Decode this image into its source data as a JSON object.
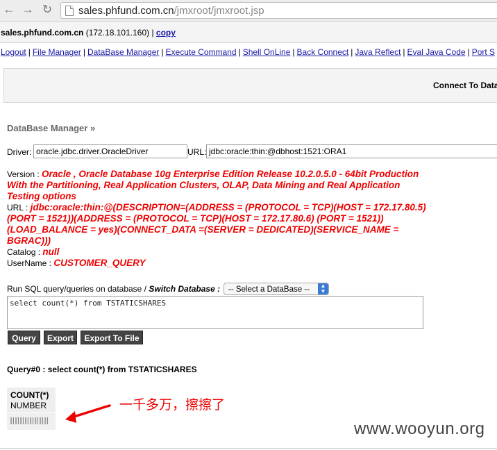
{
  "browser": {
    "url_host": "sales.phfund.com.cn",
    "url_path": "/jmxroot/jmxroot.jsp"
  },
  "header": {
    "host": "sales.phfund.com.cn",
    "ip": "(172.18.101.160)",
    "separator": "|",
    "copy_label": "copy"
  },
  "menu": [
    "Logout",
    "File Manager",
    "DataBase Manager",
    "Execute Command",
    "Shell OnLine",
    "Back Connect",
    "Java Reflect",
    "Eval Java Code",
    "Port S"
  ],
  "connect_label": "Connect To Data",
  "section_title": "DataBase Manager »",
  "driver": {
    "label": "Driver:",
    "value": "oracle.jdbc.driver.OracleDriver",
    "url_label": "URL:",
    "url_value": "jdbc:oracle:thin:@dbhost:1521:ORA1"
  },
  "info": {
    "version_label": "Version :",
    "version_value": "Oracle , Oracle Database 10g Enterprise Edition Release 10.2.0.5.0 - 64bit Production With the Partitioning, Real Application Clusters, OLAP, Data Mining and Real Application Testing options",
    "url_label": "URL :",
    "url_value": "jdbc:oracle:thin:@(DESCRIPTION=(ADDRESS = (PROTOCOL = TCP)(HOST = 172.17.80.5)(PORT = 1521))(ADDRESS = (PROTOCOL = TCP)(HOST = 172.17.80.6) (PORT = 1521))(LOAD_BALANCE = yes)(CONNECT_DATA =(SERVER = DEDICATED)(SERVICE_NAME = BGRAC)))",
    "catalog_label": "Catalog :",
    "catalog_value": "null",
    "username_label": "UserName :",
    "username_value": "CUSTOMER_QUERY"
  },
  "sql": {
    "label": "Run SQL query/queries on database /",
    "switch_label": "Switch Database :",
    "select_value": "-- Select a DataBase --",
    "query_text": "select count(*) from TSTATICSHARES"
  },
  "buttons": {
    "query": "Query",
    "export": "Export",
    "export_file": "Export To File"
  },
  "result": {
    "title": "Query#0 : select count(*) from TSTATICSHARES",
    "column_name": "COUNT(*)",
    "column_type": "NUMBER"
  },
  "annotation": "一千多万，擦擦了",
  "watermark": "www.wooyun.org",
  "colors": {
    "link": "#1a1aa6",
    "highlight_red": "#e00000",
    "button_bg": "#444444"
  }
}
